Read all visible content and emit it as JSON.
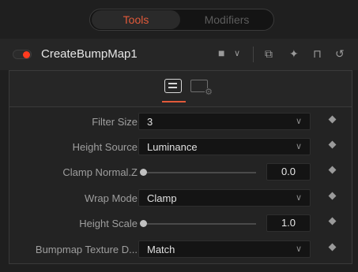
{
  "tabs": {
    "tools": "Tools",
    "modifiers": "Modifiers"
  },
  "node": {
    "name": "CreateBumpMap1",
    "enabled": true
  },
  "header_icons": [
    "color-square-icon",
    "chevron-down-icon",
    "window-icon",
    "pin-icon",
    "lock-icon",
    "reset-icon"
  ],
  "panel_tabs": [
    "controls-tab",
    "settings-tab"
  ],
  "controls": [
    {
      "label": "Filter Size",
      "type": "dropdown",
      "value": "3"
    },
    {
      "label": "Height Source",
      "type": "dropdown",
      "value": "Luminance"
    },
    {
      "label": "Clamp Normal.Z",
      "type": "slider",
      "value": "0.0"
    },
    {
      "label": "Wrap Mode",
      "type": "dropdown",
      "value": "Clamp"
    },
    {
      "label": "Height Scale",
      "type": "slider",
      "value": "1.0"
    },
    {
      "label": "Bumpmap Texture D...",
      "type": "dropdown",
      "value": "Match"
    }
  ],
  "colors": {
    "accent": "#e25a3a",
    "toggle_on": "#ff3b1f"
  }
}
